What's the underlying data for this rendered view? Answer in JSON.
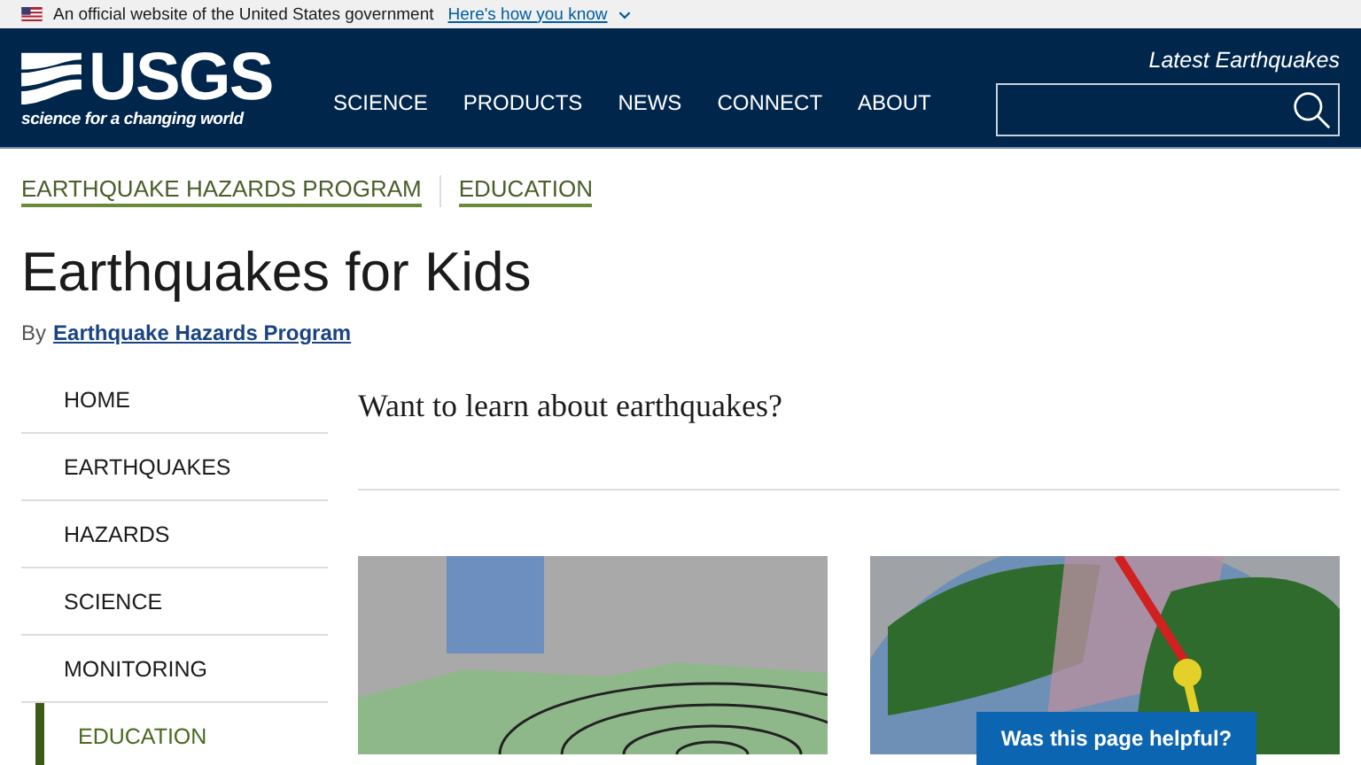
{
  "gov_banner": {
    "text": "An official website of the United States government",
    "link": "Here's how you know"
  },
  "header": {
    "logo_text": "USGS",
    "tagline": "science for a changing world",
    "nav": [
      "SCIENCE",
      "PRODUCTS",
      "NEWS",
      "CONNECT",
      "ABOUT"
    ],
    "quick_link": "Latest Earthquakes"
  },
  "breadcrumbs": [
    "EARTHQUAKE HAZARDS PROGRAM",
    "EDUCATION"
  ],
  "title": "Earthquakes for Kids",
  "byline": {
    "prefix": "By",
    "author": "Earthquake Hazards Program"
  },
  "sidebar": {
    "items": [
      {
        "label": "HOME",
        "selected": false
      },
      {
        "label": "EARTHQUAKES",
        "selected": false
      },
      {
        "label": "HAZARDS",
        "selected": false
      },
      {
        "label": "SCIENCE",
        "selected": false
      },
      {
        "label": "MONITORING",
        "selected": false
      },
      {
        "label": "EDUCATION",
        "selected": true
      }
    ]
  },
  "intro": "Want to learn about earthquakes?",
  "cards": [
    {
      "kind": "diagram"
    },
    {
      "kind": "globe"
    }
  ],
  "feedback_button": "Was this page helpful?"
}
